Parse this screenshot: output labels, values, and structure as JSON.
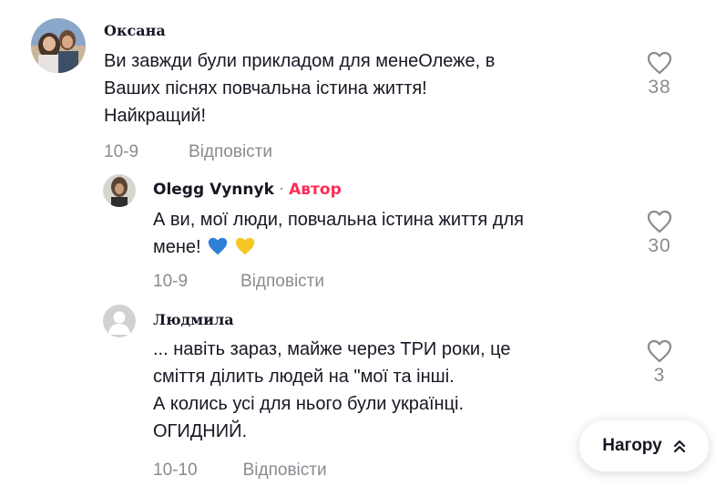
{
  "comments": [
    {
      "author": "Оксана",
      "lines": [
        "Ви завжди були прикладом для менеОлеже, в",
        "Ваших піснях повчальна істина життя!",
        "Найкращий!"
      ],
      "date": "10-9",
      "reply_label": "Відповісти",
      "likes": "38"
    },
    {
      "author": "Olegg Vynnyk",
      "separator": "·",
      "author_badge": "Автор",
      "lines": [
        "А ви, мої люди, повчальна істина життя для",
        "мене!"
      ],
      "emojis": [
        "blue-heart",
        "yellow-heart"
      ],
      "date": "10-9",
      "reply_label": "Відповісти",
      "likes": "30"
    },
    {
      "author": "Людмила",
      "lines": [
        "... навіть зараз, майже через ТРИ роки, це",
        "сміття ділить людей на \"мої та інші.",
        "А колись усі для нього були українці.",
        "ОГИДНИЙ."
      ],
      "date": "10-10",
      "reply_label": "Відповісти",
      "likes": "3"
    }
  ],
  "scroll_top_button": {
    "label": "Нагору",
    "icon": "double-chevron-up-icon"
  },
  "colors": {
    "accent": "#FE2C55",
    "muted": "#8a8b91",
    "text": "#161823"
  }
}
